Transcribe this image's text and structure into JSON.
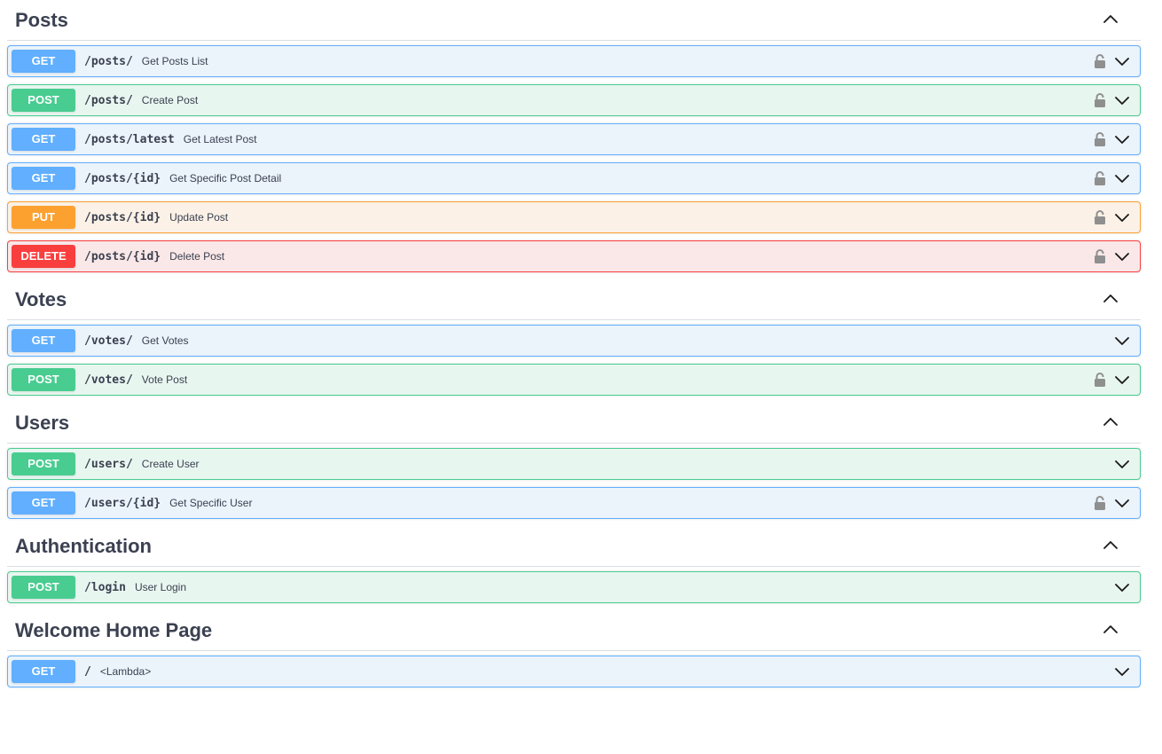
{
  "sections": [
    {
      "title": "Posts",
      "operations": [
        {
          "method": "GET",
          "path": "/posts/",
          "summary": "Get Posts List",
          "locked": true
        },
        {
          "method": "POST",
          "path": "/posts/",
          "summary": "Create Post",
          "locked": true
        },
        {
          "method": "GET",
          "path": "/posts/latest",
          "summary": "Get Latest Post",
          "locked": true
        },
        {
          "method": "GET",
          "path": "/posts/{id}",
          "summary": "Get Specific Post Detail",
          "locked": true
        },
        {
          "method": "PUT",
          "path": "/posts/{id}",
          "summary": "Update Post",
          "locked": true
        },
        {
          "method": "DELETE",
          "path": "/posts/{id}",
          "summary": "Delete Post",
          "locked": true
        }
      ]
    },
    {
      "title": "Votes",
      "operations": [
        {
          "method": "GET",
          "path": "/votes/",
          "summary": "Get Votes",
          "locked": false
        },
        {
          "method": "POST",
          "path": "/votes/",
          "summary": "Vote Post",
          "locked": true
        }
      ]
    },
    {
      "title": "Users",
      "operations": [
        {
          "method": "POST",
          "path": "/users/",
          "summary": "Create User",
          "locked": false
        },
        {
          "method": "GET",
          "path": "/users/{id}",
          "summary": "Get Specific User",
          "locked": true
        }
      ]
    },
    {
      "title": "Authentication",
      "operations": [
        {
          "method": "POST",
          "path": "/login",
          "summary": "User Login",
          "locked": false
        }
      ]
    },
    {
      "title": "Welcome Home Page",
      "operations": [
        {
          "method": "GET",
          "path": "/",
          "summary": "<Lambda>",
          "locked": false
        }
      ]
    }
  ],
  "icons": {
    "lock": "lock-icon",
    "expand": "chevron-down-icon",
    "collapse": "chevron-up-icon"
  },
  "colors": {
    "get": "#61affe",
    "post": "#49cc90",
    "put": "#fca130",
    "delete": "#f93e3e"
  }
}
